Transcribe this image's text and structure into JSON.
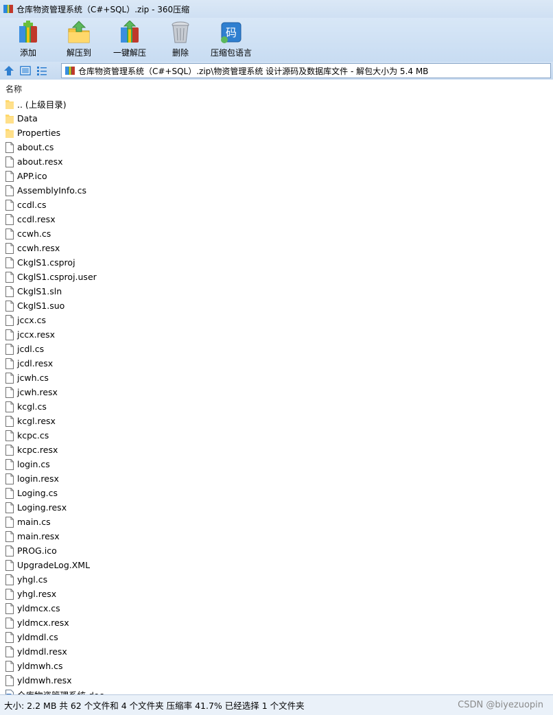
{
  "window": {
    "title": "仓库物资管理系统（C#+SQL）.zip - 360压缩"
  },
  "toolbar": {
    "add_label": "添加",
    "extract_to_label": "解压到",
    "one_click_extract_label": "一键解压",
    "delete_label": "删除",
    "language_label": "压缩包语言",
    "language_icon_glyph": "码"
  },
  "address": {
    "path": "仓库物资管理系统（C#+SQL）.zip\\物资管理系统 设计源码及数据库文件 - 解包大小为 5.4 MB"
  },
  "list_header": {
    "name_label": "名称"
  },
  "files": [
    {
      "name": ".. (上级目录)",
      "type": "folder"
    },
    {
      "name": "Data",
      "type": "folder"
    },
    {
      "name": "Properties",
      "type": "folder"
    },
    {
      "name": "about.cs",
      "type": "file"
    },
    {
      "name": "about.resx",
      "type": "file"
    },
    {
      "name": "APP.ico",
      "type": "file"
    },
    {
      "name": "AssemblyInfo.cs",
      "type": "file"
    },
    {
      "name": "ccdl.cs",
      "type": "file"
    },
    {
      "name": "ccdl.resx",
      "type": "file"
    },
    {
      "name": "ccwh.cs",
      "type": "file"
    },
    {
      "name": "ccwh.resx",
      "type": "file"
    },
    {
      "name": "CkglS1.csproj",
      "type": "file"
    },
    {
      "name": "CkglS1.csproj.user",
      "type": "file"
    },
    {
      "name": "CkglS1.sln",
      "type": "file"
    },
    {
      "name": "CkglS1.suo",
      "type": "file"
    },
    {
      "name": "jccx.cs",
      "type": "file"
    },
    {
      "name": "jccx.resx",
      "type": "file"
    },
    {
      "name": "jcdl.cs",
      "type": "file"
    },
    {
      "name": "jcdl.resx",
      "type": "file"
    },
    {
      "name": "jcwh.cs",
      "type": "file"
    },
    {
      "name": "jcwh.resx",
      "type": "file"
    },
    {
      "name": "kcgl.cs",
      "type": "file"
    },
    {
      "name": "kcgl.resx",
      "type": "file"
    },
    {
      "name": "kcpc.cs",
      "type": "file"
    },
    {
      "name": "kcpc.resx",
      "type": "file"
    },
    {
      "name": "login.cs",
      "type": "file"
    },
    {
      "name": "login.resx",
      "type": "file"
    },
    {
      "name": "Loging.cs",
      "type": "file"
    },
    {
      "name": "Loging.resx",
      "type": "file"
    },
    {
      "name": "main.cs",
      "type": "file"
    },
    {
      "name": "main.resx",
      "type": "file"
    },
    {
      "name": "PROG.ico",
      "type": "file"
    },
    {
      "name": "UpgradeLog.XML",
      "type": "file"
    },
    {
      "name": "yhgl.cs",
      "type": "file"
    },
    {
      "name": "yhgl.resx",
      "type": "file"
    },
    {
      "name": "yldmcx.cs",
      "type": "file"
    },
    {
      "name": "yldmcx.resx",
      "type": "file"
    },
    {
      "name": "yldmdl.cs",
      "type": "file"
    },
    {
      "name": "yldmdl.resx",
      "type": "file"
    },
    {
      "name": "yldmwh.cs",
      "type": "file"
    },
    {
      "name": "yldmwh.resx",
      "type": "file"
    },
    {
      "name": "仓库物资管理系统.doc",
      "type": "doc"
    }
  ],
  "status": {
    "text": "大小: 2.2 MB 共 62 个文件和 4 个文件夹 压缩率 41.7% 已经选择 1 个文件夹",
    "watermark": "CSDN @biyezuopin"
  },
  "colors": {
    "folder": "#ffd86b",
    "accent": "#2f7fd0"
  }
}
